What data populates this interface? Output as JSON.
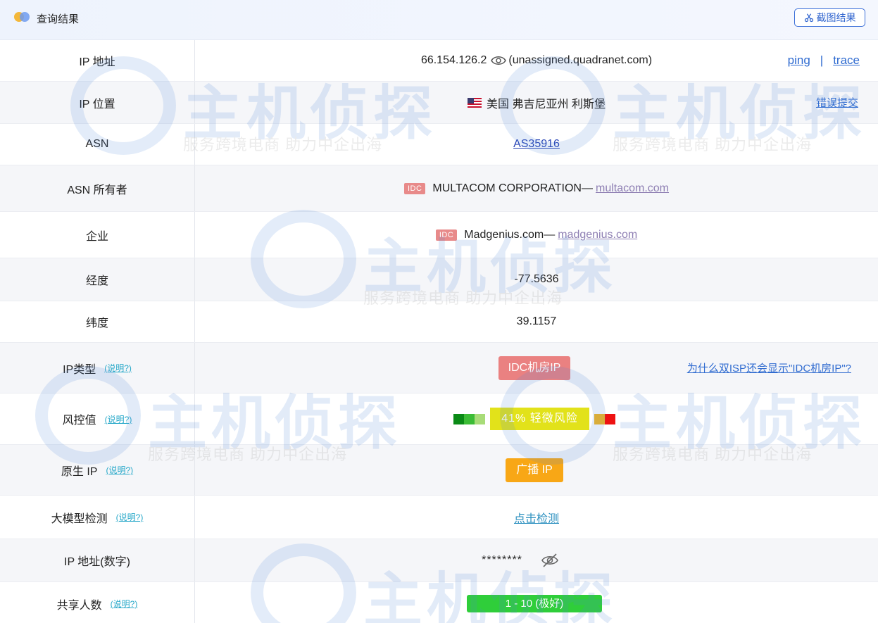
{
  "header": {
    "title": "查询结果",
    "screenshot_button": "截图结果"
  },
  "rows": {
    "ip": {
      "label": "IP 地址",
      "ip": "66.154.126.2",
      "host": "(unassigned.quadranet.com)",
      "ping": "ping",
      "sep": "|",
      "trace": "trace"
    },
    "location": {
      "label": "IP 位置",
      "flag": "us-flag-icon",
      "value": "美国 弗吉尼亚州 利斯堡",
      "report": "错误提交"
    },
    "asn": {
      "label": "ASN",
      "value": "AS35916"
    },
    "asn_owner": {
      "label": "ASN 所有者",
      "badge": "IDC",
      "name": "MULTACOM CORPORATION—",
      "domain": "multacom.com"
    },
    "company": {
      "label": "企业",
      "badge": "IDC",
      "name": "Madgenius.com—",
      "domain": "madgenius.com"
    },
    "longitude": {
      "label": "经度",
      "value": "-77.5636"
    },
    "latitude": {
      "label": "纬度",
      "value": "39.1157"
    },
    "ip_type": {
      "label": "IP类型",
      "help": "(说明?)",
      "value": "IDC机房IP",
      "why": "为什么双ISP还会显示\"IDC机房IP\"?"
    },
    "risk": {
      "label": "风控值",
      "help": "(说明?)",
      "value": "41%  轻微风险",
      "colors": [
        "#0a8a16",
        "#3cbc36",
        "#a8dc78",
        "#f5b51c",
        "#ee1212"
      ]
    },
    "native_ip": {
      "label": "原生 IP",
      "help": "(说明?)",
      "value": "广播 IP"
    },
    "llm_detect": {
      "label": "大模型检测",
      "help": "(说明?)",
      "value": "点击检测"
    },
    "ip_numeric": {
      "label": "IP 地址(数字)",
      "value": "********"
    },
    "share": {
      "label": "共享人数",
      "help": "(说明?)",
      "value": "1 - 10 (极好)"
    }
  },
  "watermark": {
    "brand": "主机侦探",
    "slogan": "服务跨境电商 助力中企出海"
  }
}
